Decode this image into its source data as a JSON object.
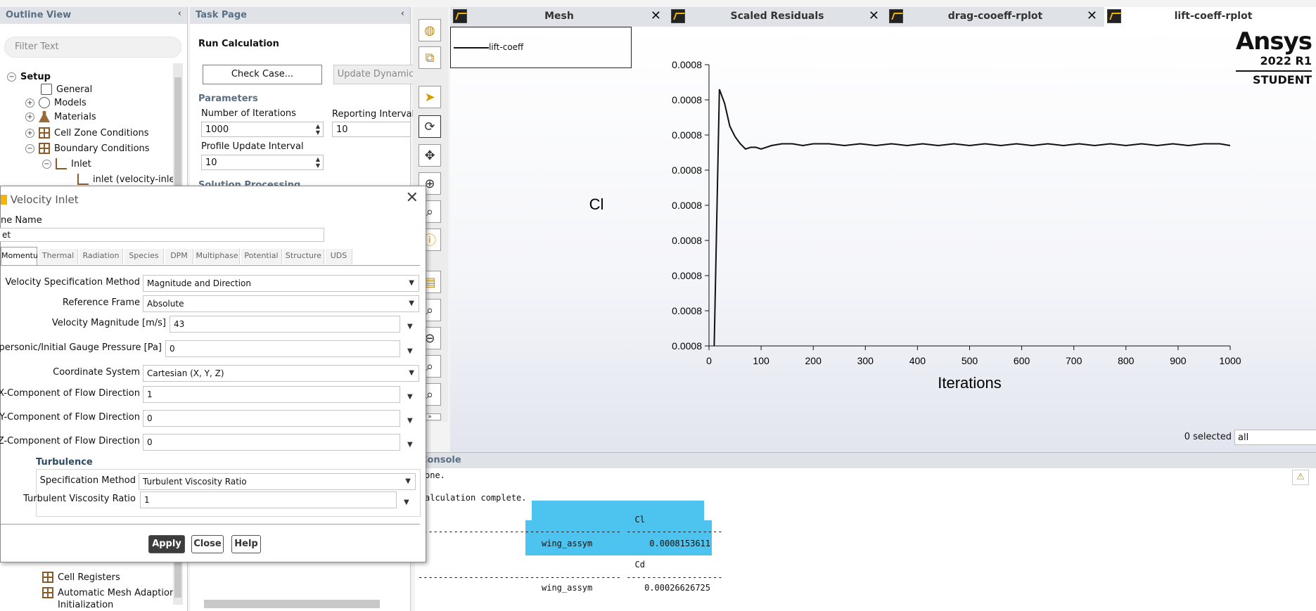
{
  "outline": {
    "title": "Outline View",
    "filter_placeholder": "Filter Text",
    "setup": "Setup",
    "general": "General",
    "models": "Models",
    "materials": "Materials",
    "cell_zone": "Cell Zone Conditions",
    "boundary": "Boundary Conditions",
    "inlet": "Inlet",
    "inlet_item": "inlet (velocity-inlet,",
    "cell_registers": "Cell Registers",
    "auto_mesh": "Automatic Mesh Adaption",
    "initialization": "Initialization"
  },
  "task": {
    "title": "Task Page",
    "run_calc": "Run Calculation",
    "check_case": "Check Case...",
    "update_dynamic": "Update Dynamic",
    "parameters": "Parameters",
    "num_iter_label": "Number of Iterations",
    "num_iter": "1000",
    "report_label": "Reporting Interval",
    "report": "10",
    "profile_label": "Profile Update Interval",
    "profile": "10",
    "solution_processing": "Solution Processing"
  },
  "tabs": {
    "mesh": "Mesh",
    "residuals": "Scaled Residuals",
    "drag": "drag-cooeff-rplot",
    "lift": "lift-coeff-rplot"
  },
  "brand": {
    "name": "Ansys",
    "version": "2022 R1",
    "edition": "STUDENT"
  },
  "selection": {
    "count": "0 selected",
    "filter": "all"
  },
  "chart_data": {
    "type": "line",
    "title": "",
    "xlabel": "Iterations",
    "ylabel": "Cl",
    "xlim": [
      0,
      1000
    ],
    "x_ticks": [
      "0",
      "100",
      "200",
      "300",
      "400",
      "500",
      "600",
      "700",
      "800",
      "900",
      "1000"
    ],
    "y_ticks": [
      "0.0008",
      "0.0008",
      "0.0008",
      "0.0008",
      "0.0008",
      "0.0008",
      "0.0008",
      "0.0008",
      "0.0008"
    ],
    "ylim": [
      0.00074,
      0.0009
    ],
    "series": [
      {
        "name": "lift-coeff",
        "x": [
          10,
          20,
          30,
          40,
          50,
          60,
          70,
          80,
          90,
          100,
          120,
          140,
          160,
          180,
          200,
          230,
          260,
          290,
          320,
          350,
          380,
          410,
          440,
          470,
          500,
          530,
          560,
          590,
          620,
          650,
          680,
          710,
          740,
          770,
          800,
          830,
          860,
          890,
          920,
          950,
          980,
          1000
        ],
        "y": [
          0.00074,
          0.000886,
          0.000878,
          0.000865,
          0.000859,
          0.000855,
          0.000852,
          0.000853,
          0.000853,
          0.000852,
          0.000854,
          0.000855,
          0.000855,
          0.000854,
          0.000855,
          0.000855,
          0.000854,
          0.000855,
          0.000854,
          0.000855,
          0.000854,
          0.000855,
          0.000854,
          0.000855,
          0.000854,
          0.000855,
          0.000854,
          0.000855,
          0.000854,
          0.000855,
          0.000854,
          0.000855,
          0.000854,
          0.000855,
          0.000854,
          0.000855,
          0.000854,
          0.000855,
          0.000854,
          0.000855,
          0.000855,
          0.000854
        ]
      }
    ]
  },
  "console": {
    "title": "Console",
    "line1": "one.",
    "line2": "alculation complete.",
    "cl_header": "Cl",
    "dash_row": "---------------------------------------- -------------------",
    "cl_name": "wing_assym",
    "cl_value": "0.0008153611",
    "cd_header": "Cd",
    "cd_name": "wing_assym",
    "cd_value": "0.00026626725"
  },
  "dialog": {
    "title": "Velocity Inlet",
    "zone_label": "ne Name",
    "zone_value": "et",
    "tabs": [
      "Momentum",
      "Thermal",
      "Radiation",
      "Species",
      "DPM",
      "Multiphase",
      "Potential",
      "Structure",
      "UDS"
    ],
    "vsm_label": "Velocity Specification Method",
    "vsm": "Magnitude and Direction",
    "ref_label": "Reference Frame",
    "ref": "Absolute",
    "vmag_label": "Velocity Magnitude [m/s]",
    "vmag": "43",
    "sup_label": "Supersonic/Initial Gauge Pressure [Pa]",
    "sup": "0",
    "coord_label": "Coordinate System",
    "coord": "Cartesian (X, Y, Z)",
    "x_label": "X-Component of Flow Direction",
    "x": "1",
    "y_label": "Y-Component of Flow Direction",
    "y": "0",
    "z_label": "Z-Component of Flow Direction",
    "z": "0",
    "turbulence": "Turbulence",
    "spec_label": "Specification Method",
    "spec": "Turbulent Viscosity Ratio",
    "tvr_label": "Turbulent Viscosity Ratio",
    "tvr": "1",
    "apply": "Apply",
    "close": "Close",
    "help": "Help"
  }
}
